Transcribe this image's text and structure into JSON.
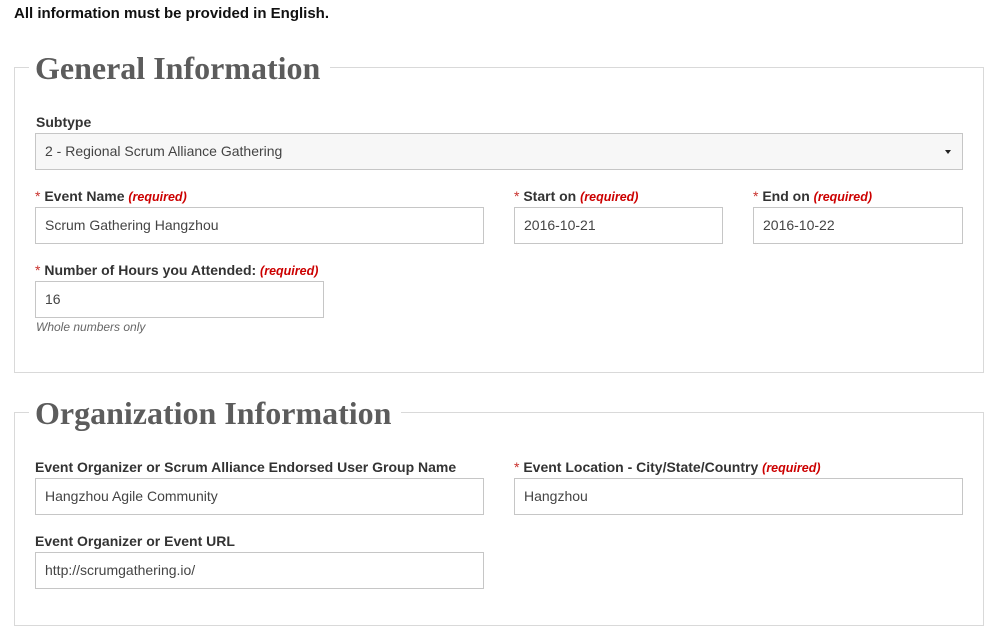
{
  "notice": "All information must be provided in English.",
  "general": {
    "legend": "General Information",
    "subtype": {
      "label": "Subtype",
      "value": "2 - Regional Scrum Alliance Gathering",
      "icon": "caret-down-icon"
    },
    "event_name": {
      "label": "Event Name",
      "required": "(required)",
      "value": "Scrum Gathering Hangzhou"
    },
    "start_on": {
      "label": "Start on",
      "required": "(required)",
      "value": "2016-10-21"
    },
    "end_on": {
      "label": "End on",
      "required": "(required)",
      "value": "2016-10-22"
    },
    "hours": {
      "label": "Number of Hours you Attended:",
      "required": "(required)",
      "value": "16",
      "hint": "Whole numbers only"
    }
  },
  "organization": {
    "legend": "Organization Information",
    "organizer": {
      "label": "Event Organizer or Scrum Alliance Endorsed User Group Name",
      "value": "Hangzhou Agile Community"
    },
    "location": {
      "label": "Event Location - City/State/Country",
      "required": "(required)",
      "value": "Hangzhou"
    },
    "url": {
      "label": "Event Organizer or Event URL",
      "value": "http://scrumgathering.io/"
    }
  },
  "colors": {
    "required": "#cc0000",
    "legend": "#5c5c5c",
    "border": "#d9d9d9"
  }
}
